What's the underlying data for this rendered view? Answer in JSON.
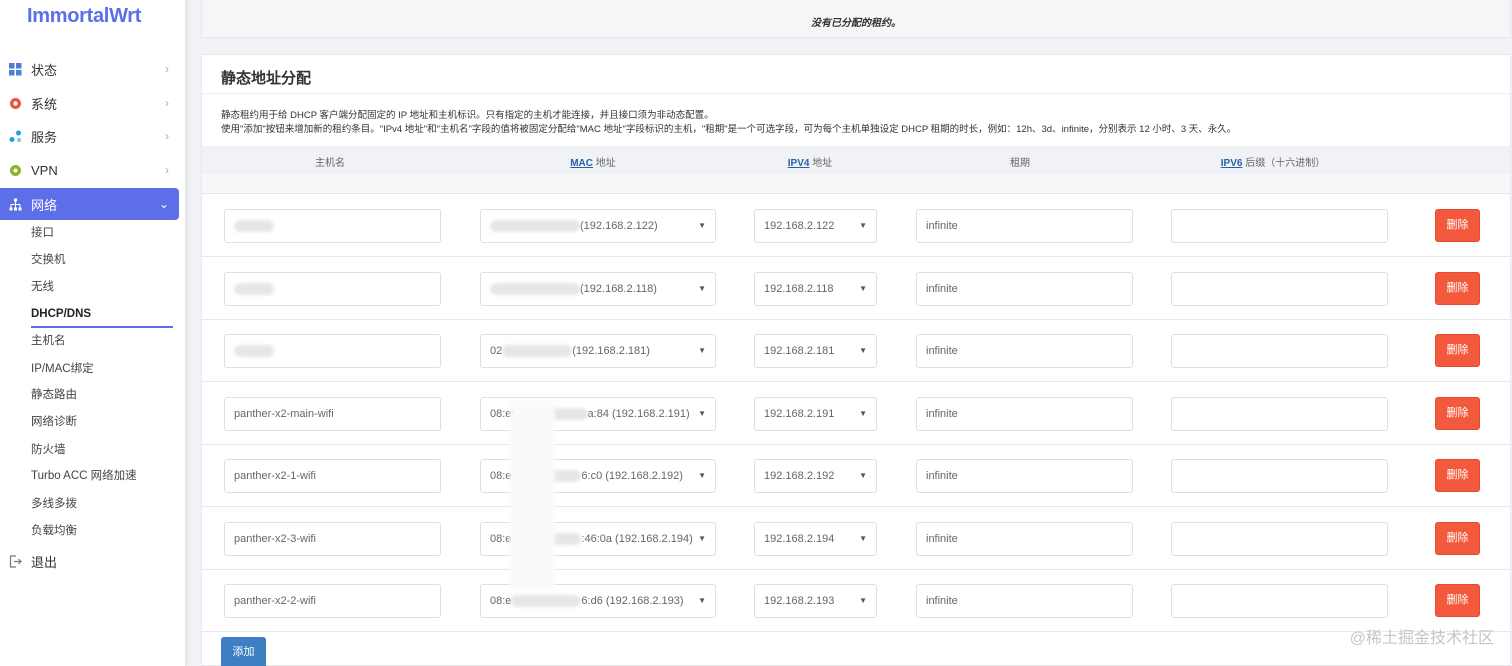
{
  "app": {
    "logo": "ImmortalWrt"
  },
  "sidebar": {
    "menu": [
      {
        "label": "状态",
        "icon": "dashboard-icon"
      },
      {
        "label": "系统",
        "icon": "gear-icon"
      },
      {
        "label": "服务",
        "icon": "nodes-icon"
      },
      {
        "label": "VPN",
        "icon": "vpn-icon"
      },
      {
        "label": "网络",
        "icon": "network-icon"
      }
    ],
    "sub": [
      "接口",
      "交换机",
      "无线",
      "DHCP/DNS",
      "主机名",
      "IP/MAC绑定",
      "静态路由",
      "网络诊断",
      "防火墙",
      "Turbo ACC 网络加速",
      "多线多拨",
      "负载均衡"
    ],
    "logout": "退出"
  },
  "top_panel": {
    "empty_text": "没有已分配的租约。"
  },
  "static": {
    "title": "静态地址分配",
    "desc1": "静态租约用于给 DHCP 客户端分配固定的 IP 地址和主机标识。只有指定的主机才能连接，并且接口须为非动态配置。",
    "desc2": "使用\"添加\"按钮来增加新的租约条目。\"IPv4 地址\"和\"主机名\"字段的值将被固定分配给\"MAC 地址\"字段标识的主机，\"租期\"是一个可选字段，可为每个主机单独设定 DHCP 租期的时长，例如：12h、3d、infinite，分别表示 12 小时、3 天、永久。",
    "headers": {
      "hostname": "主机名",
      "mac_abbr": "MAC",
      "mac_rest": " 地址",
      "ipv4_abbr": "IPV4",
      "ipv4_rest": " 地址",
      "lease": "租期",
      "ipv6_abbr": "IPV6",
      "ipv6_rest": " 后缀（十六进制）"
    },
    "rows": [
      {
        "hostname": "",
        "mac_prefix": "",
        "mac_suffix": "(192.168.2.122)",
        "ipv4": "192.168.2.122",
        "lease": "infinite",
        "ipv6": ""
      },
      {
        "hostname": "",
        "mac_prefix": "",
        "mac_suffix": "(192.168.2.118)",
        "ipv4": "192.168.2.118",
        "lease": "infinite",
        "ipv6": ""
      },
      {
        "hostname": "",
        "mac_prefix": "02",
        "mac_suffix": "(192.168.2.181)",
        "ipv4": "192.168.2.181",
        "lease": "infinite",
        "ipv6": ""
      },
      {
        "hostname": "panther-x2-main-wifi",
        "mac_prefix": "08:e9",
        "mac_suffix": "a:84 (192.168.2.191)",
        "ipv4": "192.168.2.191",
        "lease": "infinite",
        "ipv6": ""
      },
      {
        "hostname": "panther-x2-1-wifi",
        "mac_prefix": "08:e",
        "mac_suffix": "6:c0 (192.168.2.192)",
        "ipv4": "192.168.2.192",
        "lease": "infinite",
        "ipv6": ""
      },
      {
        "hostname": "panther-x2-3-wifi",
        "mac_prefix": "08:e",
        "mac_suffix": ":46:0a (192.168.2.194)",
        "ipv4": "192.168.2.194",
        "lease": "infinite",
        "ipv6": ""
      },
      {
        "hostname": "panther-x2-2-wifi",
        "mac_prefix": "08:e",
        "mac_suffix": "6:d6 (192.168.2.193)",
        "ipv4": "192.168.2.193",
        "lease": "infinite",
        "ipv6": ""
      }
    ],
    "delete_label": "删除",
    "add_label": "添加"
  },
  "watermark": "@稀土掘金技术社区",
  "colors": {
    "accent": "#5c6ee8",
    "delete": "#f35a3d",
    "add": "#3d7fc1"
  }
}
